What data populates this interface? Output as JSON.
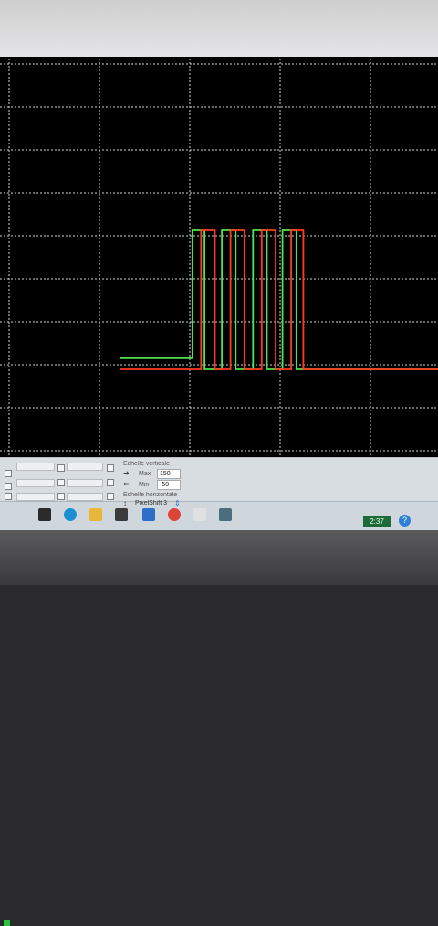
{
  "scope": {
    "grid": {
      "cols": 10,
      "rows": 10,
      "color": "#cfd3d6"
    },
    "background": "#000000",
    "traces": [
      {
        "color": "#4fe34f",
        "points": [
          [
            -0.5,
            2.8
          ],
          [
            1.6,
            2.8
          ],
          [
            1.6,
            7.4
          ],
          [
            1.95,
            7.4
          ],
          [
            1.95,
            2.4
          ],
          [
            2.45,
            2.4
          ],
          [
            2.45,
            7.4
          ],
          [
            2.85,
            7.4
          ],
          [
            2.85,
            2.4
          ],
          [
            3.35,
            2.4
          ],
          [
            3.35,
            7.4
          ],
          [
            3.75,
            7.4
          ],
          [
            3.75,
            2.4
          ],
          [
            4.2,
            2.4
          ],
          [
            4.2,
            7.4
          ],
          [
            4.6,
            7.4
          ],
          [
            4.6,
            2.4
          ],
          [
            5.2,
            2.4
          ],
          [
            5.2,
            2.4
          ],
          [
            10.2,
            2.4
          ]
        ]
      },
      {
        "color": "#ff3b26",
        "points": [
          [
            -0.5,
            2.4
          ],
          [
            1.85,
            2.4
          ],
          [
            1.85,
            7.4
          ],
          [
            2.25,
            7.4
          ],
          [
            2.25,
            2.4
          ],
          [
            2.7,
            2.4
          ],
          [
            2.7,
            7.4
          ],
          [
            3.1,
            7.4
          ],
          [
            3.1,
            2.4
          ],
          [
            3.6,
            2.4
          ],
          [
            3.6,
            7.4
          ],
          [
            4.0,
            7.4
          ],
          [
            4.0,
            2.4
          ],
          [
            4.45,
            2.4
          ],
          [
            4.45,
            7.4
          ],
          [
            4.8,
            7.4
          ],
          [
            4.8,
            2.4
          ],
          [
            10.2,
            2.4
          ]
        ]
      }
    ]
  },
  "panel": {
    "vertical_scale_title": "Echelle verticale",
    "max_label": "Max",
    "max_value": "150",
    "min_label": "Min",
    "min_value": "-50",
    "horizontal_scale_title": "Echelle horizontale",
    "pixelshift_label": "PixelShift 3"
  },
  "taskbar": {
    "clock": "2:37",
    "help": "?"
  }
}
